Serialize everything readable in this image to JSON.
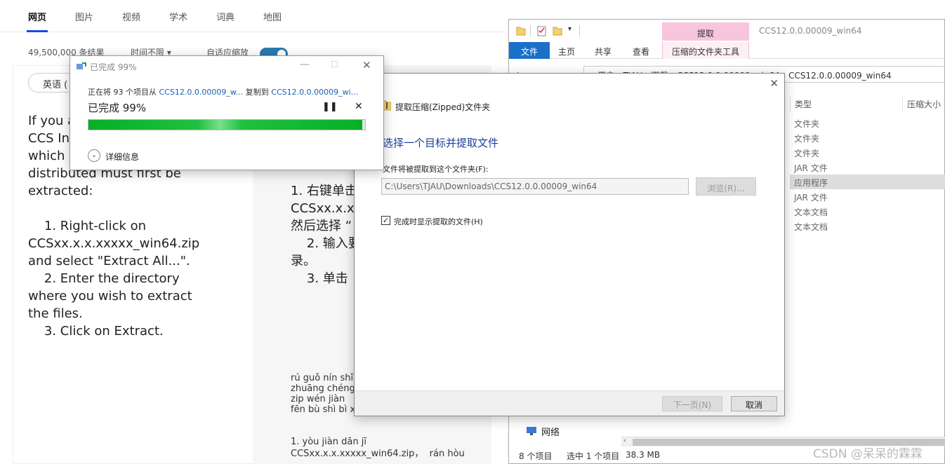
{
  "search": {
    "tabs": [
      "网页",
      "图片",
      "视频",
      "学术",
      "词典",
      "地图"
    ],
    "results_count": "49,500,000 条结果",
    "time_filter": "时间不限 ▾",
    "adaptive_zoom": "自适应缩放",
    "lang_pill": "英语 (",
    "en_text": "If you a\nCCS In\nwhich \ndistributed must first be\nextracted:\n\n    1. Right-click on\nCCSxx.x.x.xxxxx_win64.zip\nand select \"Extract All...\".\n    2. Enter the directory\nwhere you wish to extract\nthe files.\n    3. Click on Extract.",
    "zh_text": "1. 右键单击\nCCSxx.x.x.\n然后选择 “\n    2. 输入要\n录。\n    3. 单击",
    "pinyin_1": "rú guǒ nín shǐ\nzhuāng chéng\nzip wén jiàn\nfēn bù shì bì xū shǒu xiān tí qǔ:",
    "pinyin_2": "1. yòu jiàn dān jī\nCCSxx.x.x.xxxxx_win64.zip，  rán hòu"
  },
  "explorer": {
    "title": "CCS12.0.0.00009_win64",
    "context_tab": "提取",
    "ribbon_tabs": [
      "文件",
      "主页",
      "共享",
      "查看"
    ],
    "context_ribbon_tab": "压缩的文件夹工具",
    "address": "»  用户  ›  TJAU  ›  下载  ›  CCS12.0.0.00009_win64  ›  CCS12.0.0.00009_win64",
    "col_type": "类型",
    "col_compressed": "压缩大小",
    "types": [
      "文件夹",
      "文件夹",
      "文件夹",
      "JAR 文件",
      "应用程序",
      "JAR 文件",
      "文本文档",
      "文本文档"
    ],
    "selected_index": 4,
    "nav_network": "网络",
    "status_items": "8 个项目",
    "status_selected": "选中 1 个项目",
    "status_size": "38.3 MB"
  },
  "extract_dialog": {
    "header": "提取压缩(Zipped)文件夹",
    "heading": "选择一个目标并提取文件",
    "label": "文件将被提取到这个文件夹(F):",
    "path": "C:\\Users\\TJAU\\Downloads\\CCS12.0.0.00009_win64",
    "browse": "浏览(R)...",
    "checkbox_label": "完成时显示提取的文件(H)",
    "checked": true,
    "next": "下一页(N)",
    "cancel": "取消"
  },
  "copy_dialog": {
    "title": "已完成 99%",
    "desc_prefix": "正在将 93 个项目从 ",
    "desc_src": "CCS12.0.0.00009_w...",
    "desc_mid": " 复制到 ",
    "desc_dst": "CCS12.0.0.00009_wi...",
    "status": "已完成 99%",
    "progress": 0.99,
    "details": "详细信息"
  },
  "watermark": "CSDN @呆呆的霖霖",
  "colors": {
    "accent": "#174ae4",
    "progress": "#06b025",
    "file_tab": "#1a6fc9",
    "context_tab": "#f7c6dc"
  }
}
